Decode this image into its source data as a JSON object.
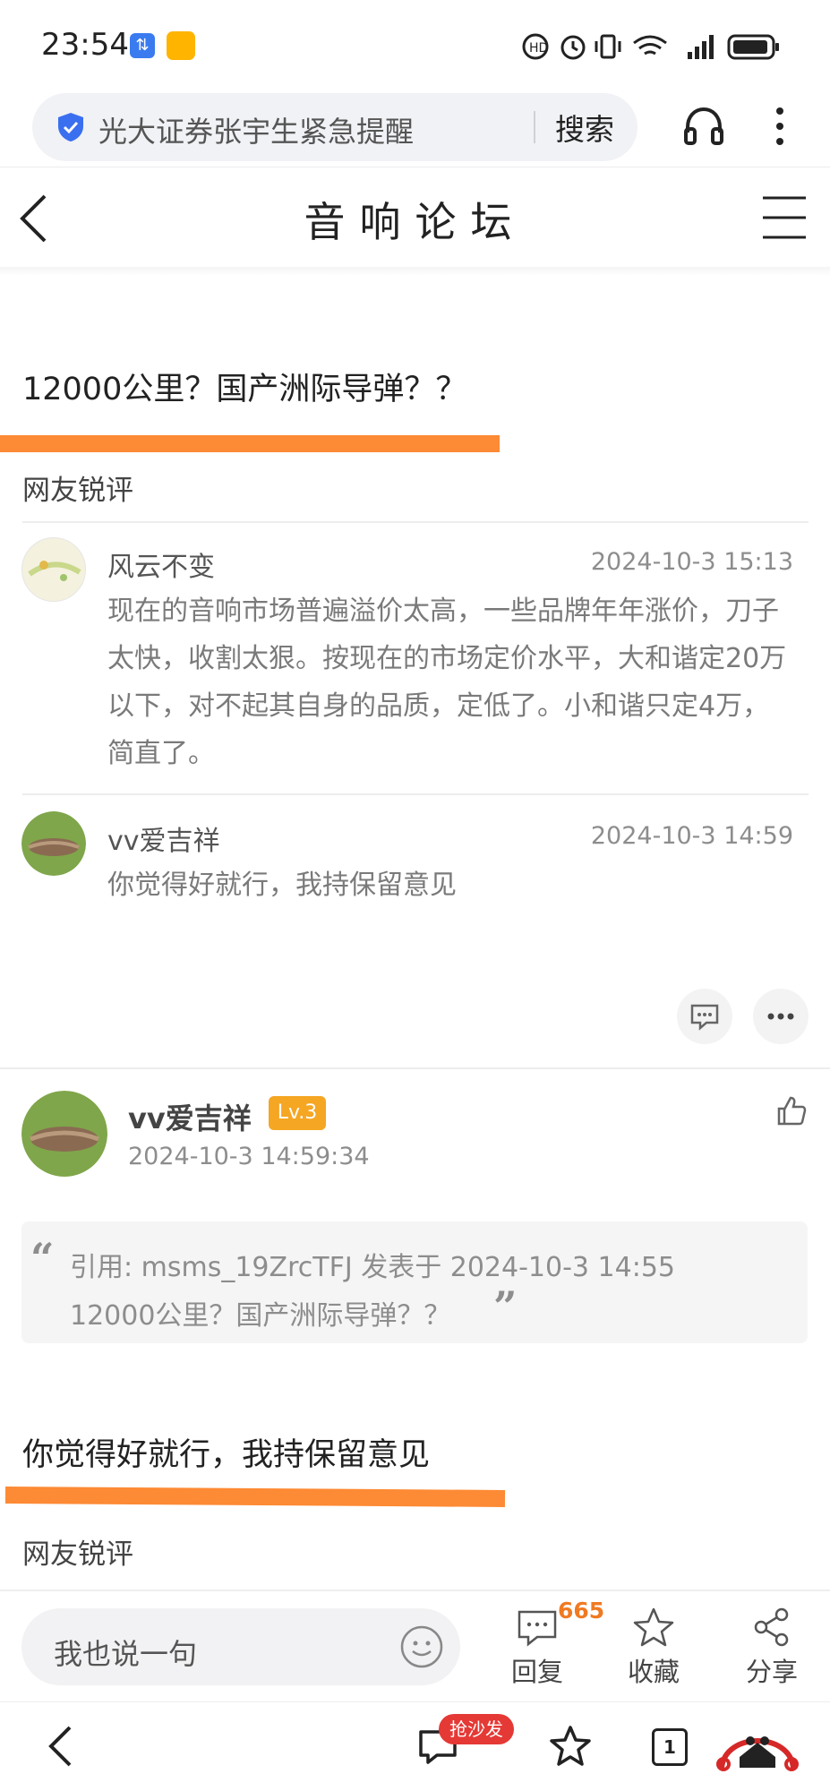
{
  "status_bar": {
    "time": "23:54",
    "icons": [
      "app-switch-icon",
      "app-badge-icon",
      "hd-call-icon",
      "alarm-icon",
      "vibrate-icon",
      "wifi-icon",
      "signal-icon",
      "battery-icon"
    ]
  },
  "browser": {
    "search_text": "光大证券张宇生紧急提醒",
    "search_button": "搜索",
    "icons": [
      "shield-check-icon",
      "headphones-icon",
      "more-vertical-icon"
    ]
  },
  "header": {
    "title": "音响论坛",
    "back_icon": "chevron-left-icon",
    "menu_icon": "menu-icon"
  },
  "post1": {
    "title": "12000公里？国产洲际导弹？？",
    "section_label": "网友锐评",
    "comments": [
      {
        "author": "风云不变",
        "time": "2024-10-3 15:13",
        "text": "现在的音响市场普遍溢价太高，一些品牌年年涨价，刀子太快，收割太狠。按现在的市场定价水平，大和谐定20万以下，对不起其自身的品质，定低了。小和谐只定4万，简直了。"
      },
      {
        "author": "vv爱吉祥",
        "time": "2024-10-3 14:59",
        "text": "你觉得好就行，我持保留意见"
      }
    ]
  },
  "reply": {
    "author": "vv爱吉祥",
    "level": "Lv.3",
    "time": "2024-10-3 14:59:34",
    "quote_line1": "引用: msms_19ZrcTFJ 发表于 2024-10-3 14:55",
    "quote_line2": "12000公里？国产洲际导弹？？",
    "body": "你觉得好就行，我持保留意见",
    "section_label": "网友锐评"
  },
  "bottom_bar": {
    "comment_placeholder": "我也说一句",
    "reply_label": "回复",
    "reply_count": "665",
    "favorite_label": "收藏",
    "share_label": "分享"
  },
  "nav_bar": {
    "badge": "抢沙发",
    "tab_count": "1"
  },
  "colors": {
    "accent_orange": "#fd8a34",
    "level_badge": "#f5a623",
    "red_badge": "#e53935"
  }
}
